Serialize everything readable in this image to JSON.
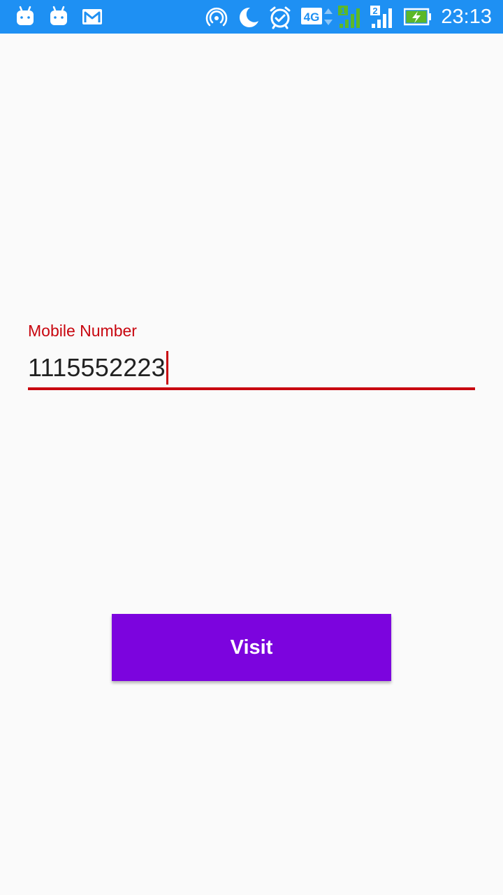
{
  "status_bar": {
    "time": "23:13",
    "background_color": "#1e90f3",
    "network_type": "4G",
    "sim1_label": "1",
    "sim2_label": "2",
    "left_icons": [
      "android-icon",
      "android-icon",
      "gmail-icon"
    ],
    "right_icons": [
      "hotspot-icon",
      "moon-icon",
      "alarm-icon",
      "4g-icon",
      "signal-sim1-icon",
      "signal-sim2-icon",
      "battery-charging-icon"
    ]
  },
  "form": {
    "mobile_label": "Mobile Number",
    "mobile_value": "1115552223",
    "accent_color": "#c8060f"
  },
  "actions": {
    "visit_label": "Visit",
    "button_color": "#7c04de"
  }
}
